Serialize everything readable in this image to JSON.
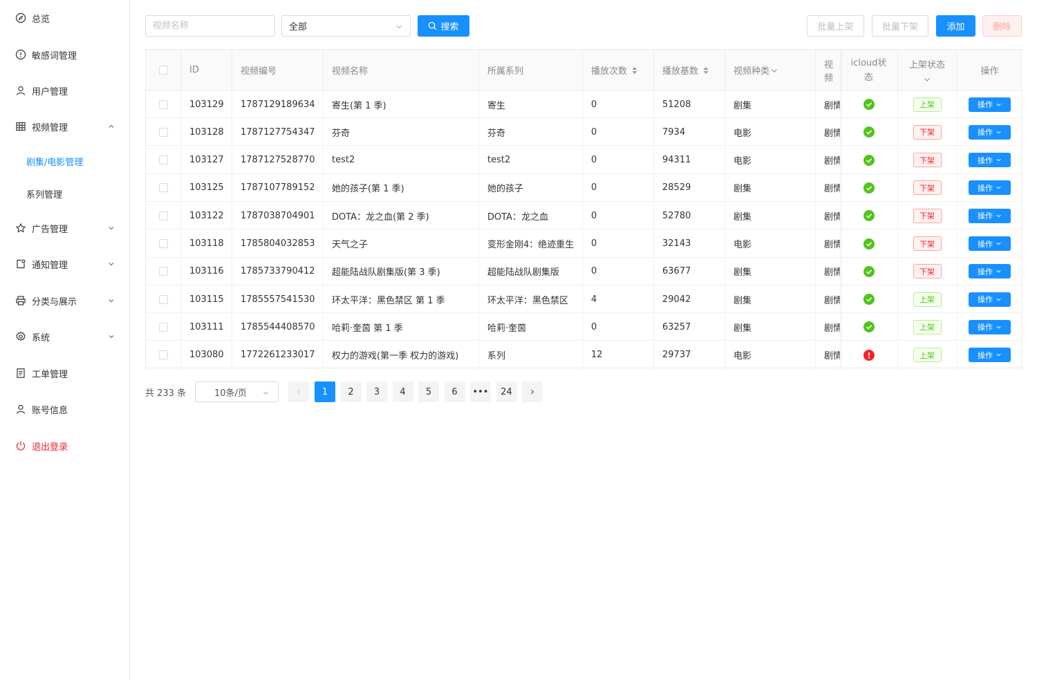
{
  "sidebar": {
    "items": [
      {
        "label": "总览",
        "icon": "compass-icon"
      },
      {
        "label": "敏感词管理",
        "icon": "alert-circle-icon"
      },
      {
        "label": "用户管理",
        "icon": "user-icon"
      },
      {
        "label": "视频管理",
        "icon": "table-icon"
      },
      {
        "label": "广告管理",
        "icon": "star-icon"
      },
      {
        "label": "通知管理",
        "icon": "notification-icon"
      },
      {
        "label": "分类与展示",
        "icon": "printer-icon"
      },
      {
        "label": "系统",
        "icon": "gear-icon"
      },
      {
        "label": "工单管理",
        "icon": "document-icon"
      },
      {
        "label": "账号信息",
        "icon": "user-icon"
      },
      {
        "label": "退出登录",
        "icon": "power-icon"
      }
    ],
    "sub_items": [
      {
        "label": "剧集/电影管理",
        "active": true
      },
      {
        "label": "系列管理",
        "active": false
      }
    ]
  },
  "toolbar": {
    "search_placeholder": "视频名称",
    "select_value": "全部",
    "search_label": "搜索",
    "batch_on_label": "批量上架",
    "batch_off_label": "批量下架",
    "add_label": "添加",
    "delete_label": "删除"
  },
  "table": {
    "headers": {
      "id": "ID",
      "code": "视频编号",
      "name": "视频名称",
      "series": "所属系列",
      "plays": "播放次数",
      "base": "播放基数",
      "kind": "视频种类",
      "type": "视频",
      "icloud_1": "icloud状",
      "icloud_2": "态",
      "shelf": "上架状态",
      "ops": "操作"
    },
    "rows": [
      {
        "id": "103129",
        "code": "1787129189634",
        "name": "寄生(第 1 季)",
        "series": "寄生",
        "plays": "0",
        "base": "51208",
        "kind": "剧集",
        "type": "剧情",
        "icloud": "ok",
        "shelf": "上架",
        "shelf_on": true
      },
      {
        "id": "103128",
        "code": "1787127754347",
        "name": "芬奇",
        "series": "芬奇",
        "plays": "0",
        "base": "7934",
        "kind": "电影",
        "type": "剧情",
        "icloud": "ok",
        "shelf": "下架",
        "shelf_on": false
      },
      {
        "id": "103127",
        "code": "1787127528770",
        "name": "test2",
        "series": "test2",
        "plays": "0",
        "base": "94311",
        "kind": "电影",
        "type": "剧情",
        "icloud": "ok",
        "shelf": "下架",
        "shelf_on": false
      },
      {
        "id": "103125",
        "code": "1787107789152",
        "name": "她的孩子(第 1 季)",
        "series": "她的孩子",
        "plays": "0",
        "base": "28529",
        "kind": "剧集",
        "type": "剧情",
        "icloud": "ok",
        "shelf": "下架",
        "shelf_on": false
      },
      {
        "id": "103122",
        "code": "1787038704901",
        "name": "DOTA：龙之血(第 2 季)",
        "series": "DOTA：龙之血",
        "plays": "0",
        "base": "52780",
        "kind": "剧集",
        "type": "剧情",
        "icloud": "ok",
        "shelf": "下架",
        "shelf_on": false
      },
      {
        "id": "103118",
        "code": "1785804032853",
        "name": "天气之子",
        "series": "变形金刚4：绝迹重生",
        "plays": "0",
        "base": "32143",
        "kind": "电影",
        "type": "剧情",
        "icloud": "ok",
        "shelf": "下架",
        "shelf_on": false
      },
      {
        "id": "103116",
        "code": "1785733790412",
        "name": "超能陆战队剧集版(第 3 季)",
        "series": "超能陆战队剧集版",
        "plays": "0",
        "base": "63677",
        "kind": "剧集",
        "type": "剧情",
        "icloud": "ok",
        "shelf": "下架",
        "shelf_on": false
      },
      {
        "id": "103115",
        "code": "1785557541530",
        "name": "环太平洋：黑色禁区 第 1 季",
        "series": "环太平洋：黑色禁区",
        "plays": "4",
        "base": "29042",
        "kind": "剧集",
        "type": "剧情",
        "icloud": "ok",
        "shelf": "上架",
        "shelf_on": true
      },
      {
        "id": "103111",
        "code": "1785544408570",
        "name": "哈莉·奎茵 第 1 季",
        "series": "哈莉·奎茵",
        "plays": "0",
        "base": "63257",
        "kind": "剧集",
        "type": "剧情",
        "icloud": "ok",
        "shelf": "上架",
        "shelf_on": true
      },
      {
        "id": "103080",
        "code": "1772261233017",
        "name": "权力的游戏(第一季 权力的游戏)",
        "series": "系列",
        "plays": "12",
        "base": "29737",
        "kind": "电影",
        "type": "剧情",
        "icloud": "error",
        "shelf": "上架",
        "shelf_on": true
      }
    ],
    "op_label": "操作"
  },
  "pagination": {
    "total": "共 233 条",
    "page_size": "10条/页",
    "pages": [
      "1",
      "2",
      "3",
      "4",
      "5",
      "6",
      "•••",
      "24"
    ],
    "current": "1"
  },
  "colors": {
    "primary": "#1890ff",
    "success": "#52c41a",
    "danger": "#f5222d"
  }
}
